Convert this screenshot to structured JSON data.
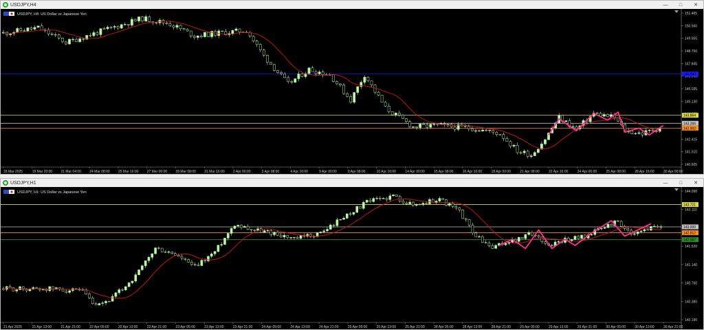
{
  "windows": [
    {
      "title": "USDJPY,H4",
      "symbol_label": "USDJPY, H4:  US Dollar vs Japanese Yen",
      "price_labels": [
        "151.465",
        "150.560",
        "149.655",
        "148.750",
        "147.845",
        "146.940",
        "146.035",
        "145.130",
        "144.225",
        "143.320",
        "142.415",
        "141.510",
        "140.605"
      ],
      "time_labels": [
        "18 Mar 2025",
        "19 Mar 20:00",
        "21 Mar 04:00",
        "24 Mar 08:00",
        "25 Mar 16:00",
        "27 Mar 00:00",
        "28 Mar 08:00",
        "31 Mar 16:00",
        "2 Apr 00:00",
        "3 Apr 08:00",
        "4 Apr 16:00",
        "9 Apr 00:00",
        "9 Apr 08:00",
        "10 Apr 16:00",
        "14 Apr 00:00",
        "15 Apr 08:00",
        "16 Apr 16:00",
        "18 Apr 00:00",
        "21 Apr 08:00",
        "22 Apr 16:00",
        "24 Apr 00:00",
        "25 Apr 08:00",
        "28 Apr 16:00",
        "30 Apr 00:00"
      ],
      "levels": [
        {
          "price": 146.94,
          "color": "#1a1aff",
          "tag": "146.940"
        },
        {
          "price": 143.864,
          "color": "#d9d94a",
          "tag": "143.864"
        },
        {
          "price": 143.266,
          "color": "#c0c0c0",
          "tag": "143.266"
        },
        {
          "price": 142.902,
          "color": "#ff8c1a",
          "tag": "142.902"
        }
      ],
      "ylim": [
        140.2,
        151.6
      ],
      "seed": 11,
      "n": 190,
      "path_anchors": [
        [
          0,
          150.0
        ],
        [
          10,
          150.4
        ],
        [
          18,
          149.3
        ],
        [
          30,
          150.3
        ],
        [
          40,
          151.1
        ],
        [
          48,
          150.7
        ],
        [
          55,
          149.8
        ],
        [
          62,
          150.0
        ],
        [
          70,
          150.2
        ],
        [
          75,
          148.3
        ],
        [
          82,
          146.2
        ],
        [
          88,
          147.3
        ],
        [
          94,
          146.9
        ],
        [
          100,
          145.0
        ],
        [
          104,
          146.9
        ],
        [
          110,
          144.4
        ],
        [
          118,
          143.0
        ],
        [
          125,
          143.1
        ],
        [
          135,
          142.9
        ],
        [
          143,
          142.5
        ],
        [
          148,
          141.2
        ],
        [
          152,
          140.9
        ],
        [
          156,
          142.1
        ],
        [
          160,
          143.7
        ],
        [
          165,
          142.8
        ],
        [
          170,
          144.0
        ],
        [
          176,
          143.7
        ],
        [
          179,
          142.7
        ],
        [
          184,
          142.5
        ],
        [
          190,
          143.0
        ]
      ],
      "zigzag": [
        [
          157,
          142.4
        ],
        [
          160,
          143.6
        ],
        [
          165,
          142.7
        ],
        [
          170,
          144.0
        ],
        [
          174,
          143.5
        ],
        [
          177,
          144.1
        ],
        [
          179,
          142.6
        ],
        [
          183,
          142.9
        ],
        [
          186,
          142.4
        ],
        [
          190,
          143.1
        ]
      ]
    },
    {
      "title": "USDJPY,H1",
      "symbol_label": "USDJPY, H1:  US Dollar vs Japanese Yen",
      "price_labels": [
        "144.090",
        "143.110",
        "142.310",
        "141.520",
        "141.140",
        "140.760",
        "140.380",
        "140.190"
      ],
      "time_labels": [
        "21 Apr 2025",
        "21 Apr 13:00",
        "21 Apr 21:00",
        "22 Apr 05:00",
        "22 Apr 13:00",
        "22 Apr 21:00",
        "23 Apr 05:00",
        "23 Apr 13:00",
        "23 Apr 21:00",
        "24 Apr 05:00",
        "24 Apr 13:00",
        "24 Apr 21:00",
        "25 Apr 05:00",
        "25 Apr 13:00",
        "25 Apr 21:00",
        "28 Apr 05:00",
        "28 Apr 13:00",
        "28 Apr 21:00",
        "29 Apr 05:00",
        "29 Apr 13:00",
        "29 Apr 21:00",
        "30 Apr 05:00",
        "30 Apr 13:00",
        "30 Apr 21:00"
      ],
      "levels": [
        {
          "price": 143.721,
          "color": "#d9d94a",
          "tag": "143.721"
        },
        {
          "price": 143.0,
          "color": "#c0c0c0",
          "tag": "143.000"
        },
        {
          "price": 142.812,
          "color": "#ff8c1a",
          "tag": "142.812"
        },
        {
          "price": 142.587,
          "color": "#2e8b2e",
          "tag": "142.587"
        }
      ],
      "ylim": [
        140.0,
        144.2
      ],
      "seed": 29,
      "n": 200,
      "path_anchors": [
        [
          0,
          141.0
        ],
        [
          15,
          141.0
        ],
        [
          24,
          140.9
        ],
        [
          28,
          140.4
        ],
        [
          33,
          140.7
        ],
        [
          40,
          141.4
        ],
        [
          46,
          142.3
        ],
        [
          52,
          142.1
        ],
        [
          58,
          141.7
        ],
        [
          64,
          142.2
        ],
        [
          70,
          143.1
        ],
        [
          76,
          142.9
        ],
        [
          82,
          142.8
        ],
        [
          88,
          142.6
        ],
        [
          96,
          142.8
        ],
        [
          104,
          143.4
        ],
        [
          110,
          143.8
        ],
        [
          118,
          144.0
        ],
        [
          124,
          143.7
        ],
        [
          132,
          143.9
        ],
        [
          138,
          143.5
        ],
        [
          143,
          142.7
        ],
        [
          148,
          142.3
        ],
        [
          152,
          142.5
        ],
        [
          156,
          142.6
        ],
        [
          160,
          142.8
        ],
        [
          165,
          142.4
        ],
        [
          170,
          142.6
        ],
        [
          176,
          142.7
        ],
        [
          180,
          142.9
        ],
        [
          186,
          143.2
        ],
        [
          190,
          142.7
        ],
        [
          196,
          143.0
        ],
        [
          200,
          143.1
        ]
      ],
      "zigzag": [
        [
          150,
          142.4
        ],
        [
          154,
          142.6
        ],
        [
          158,
          142.3
        ],
        [
          162,
          142.9
        ],
        [
          166,
          142.3
        ],
        [
          170,
          142.6
        ],
        [
          173,
          142.4
        ],
        [
          178,
          142.8
        ],
        [
          184,
          143.2
        ],
        [
          188,
          142.7
        ],
        [
          192,
          142.9
        ],
        [
          196,
          143.1
        ]
      ]
    }
  ]
}
